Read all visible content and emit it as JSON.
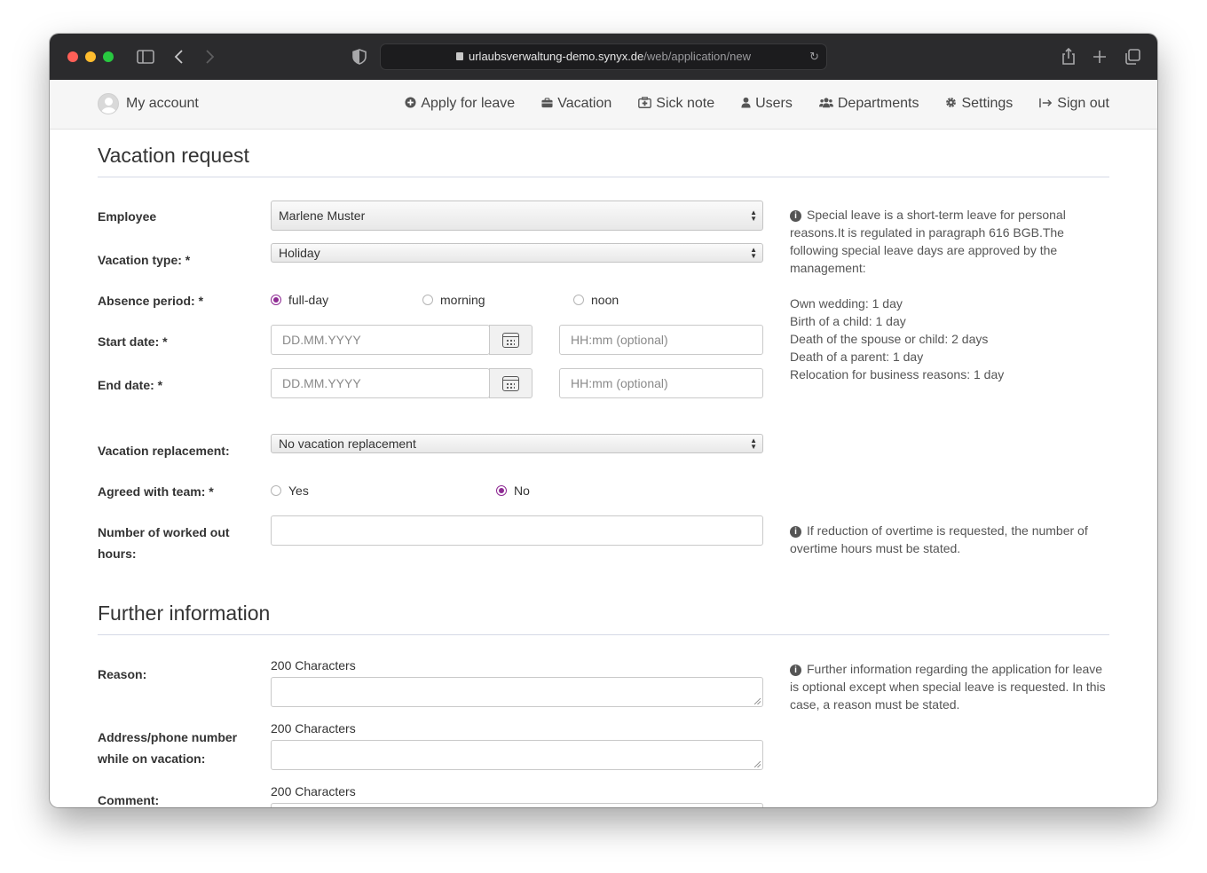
{
  "browser": {
    "url_domain": "urlaubsverwaltung-demo.synyx.de",
    "url_path": "/web/application/new"
  },
  "nav": {
    "account": "My account",
    "items": [
      {
        "label": "Apply for leave",
        "icon": "plus-circle-icon"
      },
      {
        "label": "Vacation",
        "icon": "briefcase-icon"
      },
      {
        "label": "Sick note",
        "icon": "medkit-icon"
      },
      {
        "label": "Users",
        "icon": "user-icon"
      },
      {
        "label": "Departments",
        "icon": "group-icon"
      },
      {
        "label": "Settings",
        "icon": "gear-icon"
      },
      {
        "label": "Sign out",
        "icon": "sign-out-icon"
      }
    ]
  },
  "form": {
    "title": "Vacation request",
    "employee_label": "Employee",
    "employee_value": "Marlene Muster",
    "vacation_type_label": "Vacation type: *",
    "vacation_type_value": "Holiday",
    "absence_label": "Absence period: *",
    "absence_options": [
      "full-day",
      "morning",
      "noon"
    ],
    "absence_selected": "full-day",
    "start_label": "Start date: *",
    "end_label": "End date: *",
    "date_placeholder": "DD.MM.YYYY",
    "time_placeholder": "HH:mm (optional)",
    "replacement_label": "Vacation replacement:",
    "replacement_value": "No vacation replacement",
    "agreed_label": "Agreed with team: *",
    "agreed_options": [
      "Yes",
      "No"
    ],
    "agreed_selected": "No",
    "hours_label_line1": "Number of worked out",
    "hours_label_line2": "hours:",
    "hours_value": ""
  },
  "help": {
    "special_leave_intro": "Special leave is a short-term leave for personal reasons.It is regulated in paragraph 616 BGB.The following special leave days are approved by the management:",
    "special_leave_items": [
      "Own wedding: 1 day",
      "Birth of a child: 1 day",
      "Death of the spouse or child: 2 days",
      "Death of a parent: 1 day",
      "Relocation for business reasons: 1 day"
    ],
    "overtime": "If reduction of overtime is requested, the number of overtime hours must be stated.",
    "further": "Further information regarding the application for leave is optional except when special leave is requested. In this case, a reason must be stated."
  },
  "further": {
    "title": "Further information",
    "reason_label": "Reason:",
    "address_label_line1": "Address/phone number",
    "address_label_line2": "while on vacation:",
    "comment_label": "Comment:",
    "chars_hint": "200 Characters"
  }
}
